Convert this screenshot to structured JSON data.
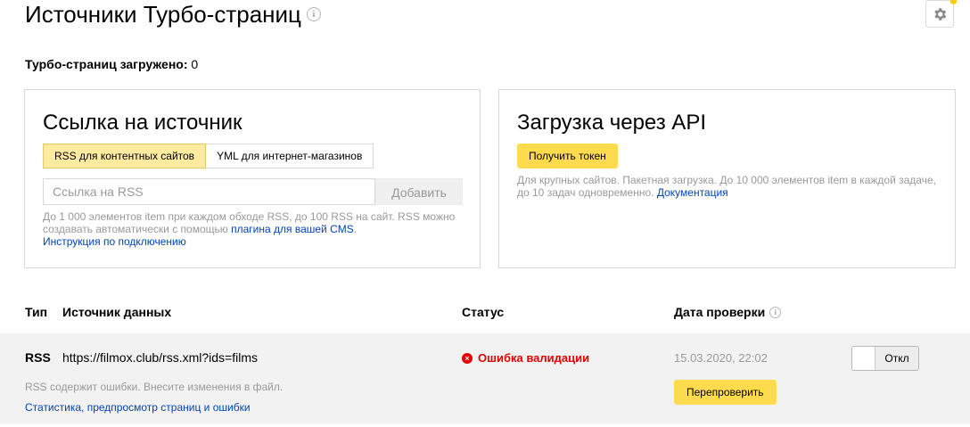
{
  "page": {
    "title": "Источники Турбо-страниц",
    "info_icon_glyph": "i",
    "loaded_label": "Турбо-страниц загружено:",
    "loaded_count": "0"
  },
  "source_panel": {
    "title": "Ссылка на источник",
    "tabs": [
      {
        "label": "RSS для контентных сайтов",
        "active": true
      },
      {
        "label": "YML для интернет-магазинов",
        "active": false
      }
    ],
    "input_placeholder": "Ссылка на RSS",
    "add_button": "Добавить",
    "hint_text": "До 1 000 элементов item при каждом обходе RSS, до 100 RSS на сайт. RSS можно создавать автоматически с помощью ",
    "hint_link": "плагина для вашей CMS",
    "hint_end": ".",
    "instruction_link": "Инструкция по подключению"
  },
  "api_panel": {
    "title": "Загрузка через API",
    "token_button": "Получить токен",
    "hint_text": "Для крупных сайтов. Пакетная загрузка. До 10 000 элементов item в каждой задаче, до 10 задач одновременно. ",
    "doc_link": "Документация"
  },
  "table": {
    "headers": {
      "type": "Тип",
      "source": "Источник данных",
      "status": "Статус",
      "date": "Дата проверки"
    },
    "rows": [
      {
        "type": "RSS",
        "url": "https://filmox.club/rss.xml?ids=films",
        "status": "Ошибка валидации",
        "status_icon": "×",
        "date": "15.03.2020, 22:02",
        "toggle_label": "Откл",
        "recheck_button": "Перепроверить",
        "hint": "RSS содержит ошибки. Внесите изменения в файл.",
        "stats_link": "Статистика, предпросмотр страниц и ошибки"
      }
    ]
  },
  "colors": {
    "accent_yellow": "#ffdb4d",
    "link_blue": "#0044bb",
    "error_red": "#e60000"
  }
}
